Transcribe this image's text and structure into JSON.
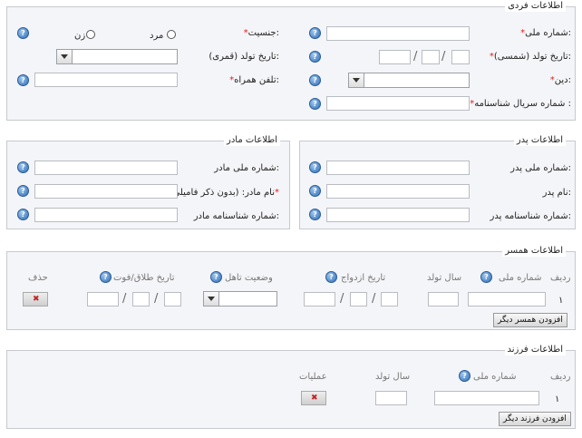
{
  "personal": {
    "legend": "اطلاعات فردی",
    "national_id": "شماره ملی:",
    "birth_date_solar": "تاریخ تولد (شمسی):",
    "religion": "دین:",
    "cert_serial": "شماره سریال شناسنامه :",
    "gender": "جنسیت:",
    "male": "مرد",
    "female": "زن",
    "birth_date_lunar": "تاریخ تولد (قمری):",
    "mobile": "تلفن همراه:",
    "required": "*"
  },
  "father": {
    "legend": "اطلاعات پدر",
    "national_id": "شماره ملی پدر:",
    "name": "نام پدر:",
    "cert_no": "شماره شناسنامه پدر:"
  },
  "mother": {
    "legend": "اطلاعات مادر",
    "national_id": "شماره ملی مادر:",
    "name": "نام مادر: (بدون ذکر فامیلی)",
    "cert_no": "شماره شناسنامه مادر:",
    "required": "*"
  },
  "spouse": {
    "legend": "اطلاعات همسر",
    "headers": {
      "row": "ردیف",
      "national_id": "شماره ملی",
      "birth_year": "سال تولد",
      "marriage_date": "تاریخ ازدواج",
      "marital_status": "وضعیت تاهل",
      "divorce_date": "تاریخ طلاق/فوت",
      "delete": "حذف"
    },
    "row_number": "۱",
    "add_button": "افزودن همسر دیگر"
  },
  "children": {
    "legend": "اطلاعات فرزند",
    "headers": {
      "row": "ردیف",
      "national_id": "شماره ملی",
      "birth_year": "سال تولد",
      "operations": "عملیات"
    },
    "row_number": "۱",
    "add_button": "افزودن فرزند دیگر"
  },
  "icons": {
    "help": "help-icon",
    "delete": "delete-x-icon",
    "dropdown": "chevron-down-icon"
  },
  "colors": {
    "help_blue": "#2f6fb6",
    "required_red": "#e02020",
    "panel_bg": "#f4f5f8"
  }
}
